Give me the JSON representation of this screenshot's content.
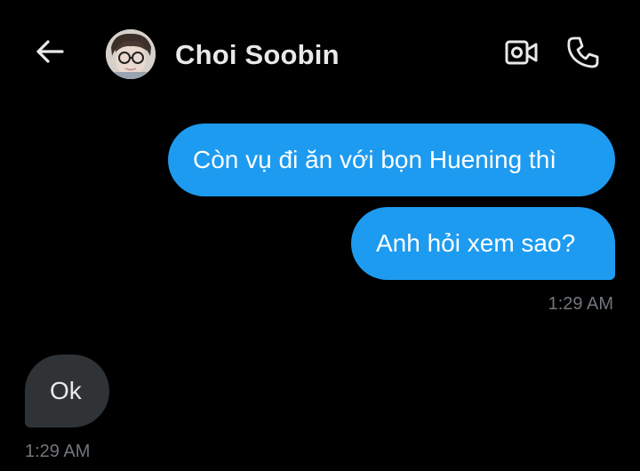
{
  "header": {
    "back_icon": "arrow-left-icon",
    "contact_name": "Choi Soobin",
    "video_icon": "video-camera-icon",
    "call_icon": "phone-icon"
  },
  "messages": [
    {
      "direction": "sent",
      "text": "Còn vụ đi ăn với bọn Huening thì"
    },
    {
      "direction": "sent",
      "text": "Anh hỏi xem sao?",
      "time": "1:29 AM"
    },
    {
      "direction": "received",
      "text": "Ok",
      "time": "1:29 AM"
    }
  ],
  "colors": {
    "background": "#000000",
    "sent_bubble": "#1d9bf0",
    "received_bubble": "#2f3336",
    "timestamp": "#71767b",
    "text": "#e7e9ea"
  }
}
